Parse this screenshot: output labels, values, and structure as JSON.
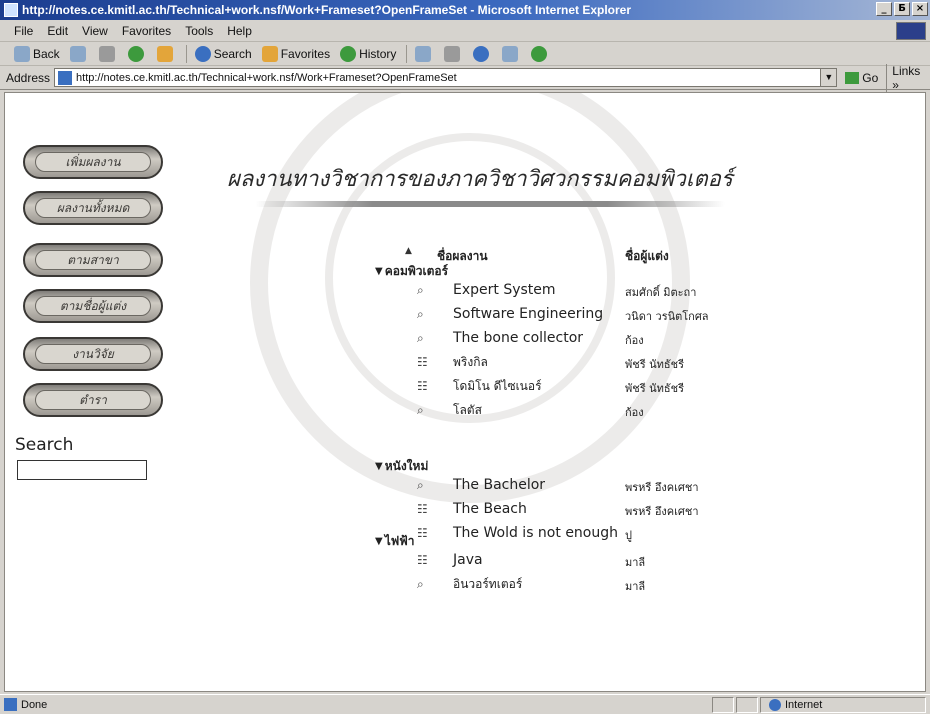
{
  "window": {
    "title": "http://notes.ce.kmitl.ac.th/Technical+work.nsf/Work+Frameset?OpenFrameSet - Microsoft Internet Explorer",
    "controls": [
      "_",
      "Б",
      "×"
    ]
  },
  "menu": [
    "File",
    "Edit",
    "View",
    "Favorites",
    "Tools",
    "Help"
  ],
  "toolbar": {
    "back": "Back",
    "search": "Search",
    "favorites": "Favorites",
    "history": "History"
  },
  "address": {
    "label": "Address",
    "url": "http://notes.ce.kmitl.ac.th/Technical+work.nsf/Work+Frameset?OpenFrameSet",
    "go": "Go",
    "links": "Links »"
  },
  "sidebar": {
    "buttons": [
      "เพิ่มผลงาน",
      "ผลงานทั้งหมด",
      "ตามสาขา",
      "ตามชื่อผู้แต่ง",
      "งานวิจัย",
      "ตำรา"
    ],
    "search_label": "Search",
    "search_value": ""
  },
  "main": {
    "heading": "ผลงานทางวิชาการของภาควิชาวิศวกรรมคอมพิวเตอร์",
    "columns": {
      "title": "ชื่อผลงาน",
      "author": "ชื่อผู้แต่ง"
    },
    "categories": [
      {
        "name": "คอมพิวเตอร์",
        "items": [
          {
            "icon": "magnifier-icon",
            "title": "Expert System",
            "author": "สมศักดิ์ มิตะถา"
          },
          {
            "icon": "magnifier-icon",
            "title": "Software Engineering",
            "author": "วนิดา วรนิตโกศล"
          },
          {
            "icon": "magnifier-icon",
            "title": "The bone collector",
            "author": "ก้อง"
          },
          {
            "icon": "book-icon",
            "title": "พริงกิล",
            "author": "พัชรี นัทธัชรี"
          },
          {
            "icon": "book-icon",
            "title": "โดมิโน ดีไซเนอร์",
            "author": "พัชรี นัทธัชรี"
          },
          {
            "icon": "magnifier-icon",
            "title": "โลตัส",
            "author": "ก้อง"
          }
        ]
      },
      {
        "name": "หนังใหม่",
        "items": [
          {
            "icon": "magnifier-icon",
            "title": "The Bachelor",
            "author": "พรหรี อึงคเศชา"
          },
          {
            "icon": "book-icon",
            "title": "The Beach",
            "author": "พรหรี อึงคเศชา"
          },
          {
            "icon": "book-icon",
            "title": "The Wold is not enough",
            "author": "ปู"
          }
        ]
      },
      {
        "name": "ไฟฟ้า",
        "items": [
          {
            "icon": "book-icon",
            "title": "Java",
            "author": "มาลี"
          },
          {
            "icon": "magnifier-icon",
            "title": "อินวอร์ทเตอร์",
            "author": "มาลี"
          }
        ]
      }
    ]
  },
  "status": {
    "text": "Done",
    "zone": "Internet"
  }
}
